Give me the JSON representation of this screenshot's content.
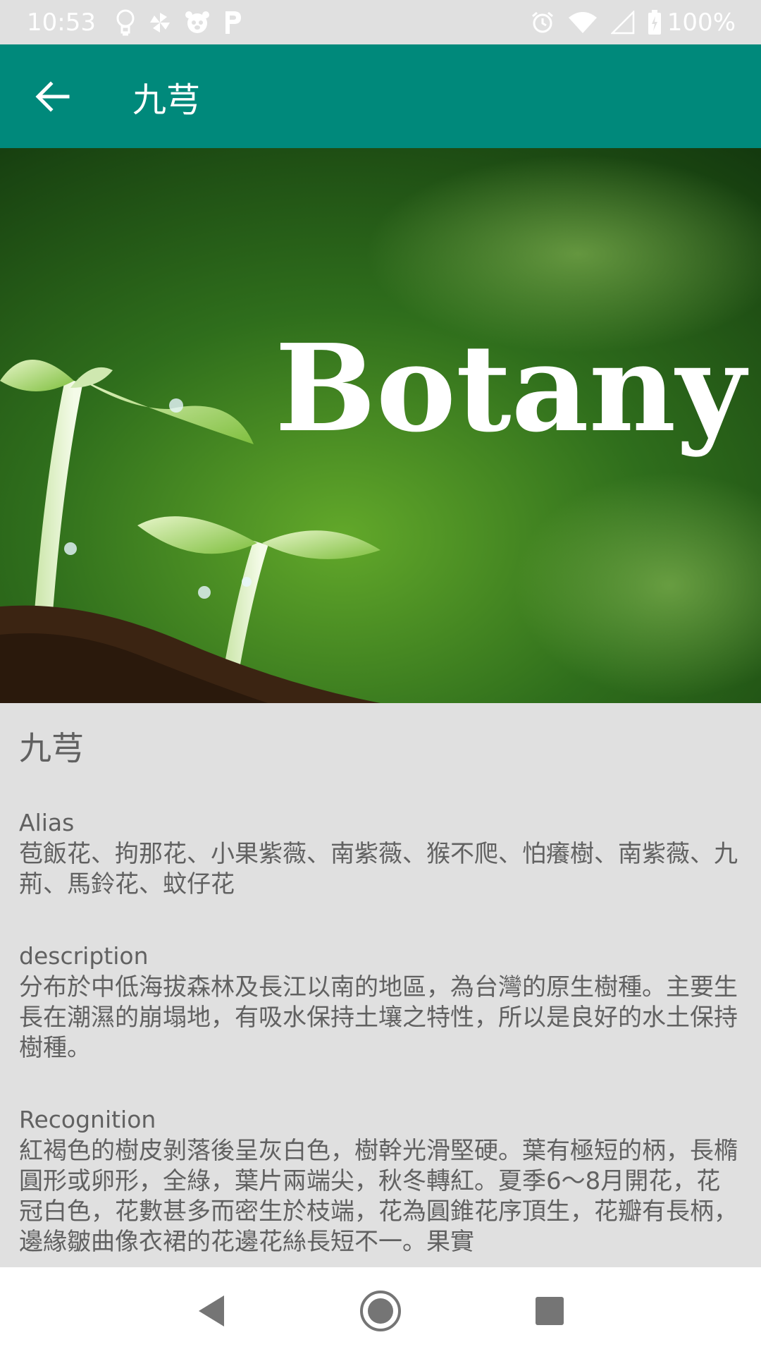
{
  "status_bar": {
    "time": "10:53",
    "battery": "100%",
    "icons": [
      "bulb-icon",
      "pinwheel-icon",
      "bear-icon",
      "p-icon",
      "alarm-icon",
      "wifi-icon",
      "signal-icon",
      "battery-icon"
    ]
  },
  "app_bar": {
    "title": "九芎",
    "back_icon": "arrow-left-icon",
    "color": "#00897b"
  },
  "hero": {
    "text": "Botany"
  },
  "detail": {
    "name": "九芎",
    "sections": [
      {
        "label": "Alias",
        "text": "苞飯花、拘那花、小果紫薇、南紫薇、猴不爬、怕癢樹、南紫薇、九荊、馬鈴花、蚊仔花"
      },
      {
        "label": "description",
        "text": "分布於中低海拔森林及長江以南的地區，為台灣的原生樹種。主要生長在潮濕的崩塌地，有吸水保持土壤之特性，所以是良好的水土保持樹種。"
      },
      {
        "label": "Recognition",
        "text": "紅褐色的樹皮剝落後呈灰白色，樹幹光滑堅硬。葉有極短的柄，長橢圓形或卵形，全綠，葉片兩端尖，秋冬轉紅。夏季6～8月開花，花冠白色，花數甚多而密生於枝端，花為圓錐花序頂生，花瓣有長柄，邊緣皺曲像衣裙的花邊花絲長短不一。果實"
      }
    ]
  },
  "nav_bar": {
    "buttons": [
      "back-triangle-icon",
      "home-circle-icon",
      "recents-square-icon"
    ]
  }
}
